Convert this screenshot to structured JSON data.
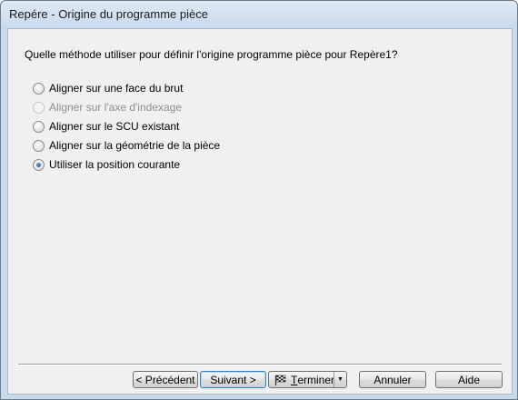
{
  "window": {
    "title": "Repére - Origine du programme pièce"
  },
  "question": "Quelle méthode utiliser pour définir l'origine programme pièce pour Repère1?",
  "options": [
    {
      "label": "Aligner sur une face du brut",
      "checked": false,
      "disabled": false
    },
    {
      "label": "Aligner sur l'axe d'indexage",
      "checked": false,
      "disabled": true
    },
    {
      "label": "Aligner sur le SCU existant",
      "checked": false,
      "disabled": false
    },
    {
      "label": "Aligner sur la géométrie de la pièce",
      "checked": false,
      "disabled": false
    },
    {
      "label": "Utiliser la position courante",
      "checked": true,
      "disabled": false
    }
  ],
  "buttons": {
    "previous": "< Précédent",
    "next": "Suivant >",
    "finish_prefix": "",
    "finish_underlined": "T",
    "finish_rest": "erminer",
    "cancel": "Annuler",
    "help": "Aide"
  },
  "icons": {
    "finish": "checkered-flag-icon",
    "dropdown": "dropdown-arrow-icon"
  },
  "colors": {
    "title_bar": "#c9daed",
    "client_bg": "#f0f0f0",
    "selected_radio": "#1c4e8f",
    "disabled_text": "#8d8d8d"
  }
}
